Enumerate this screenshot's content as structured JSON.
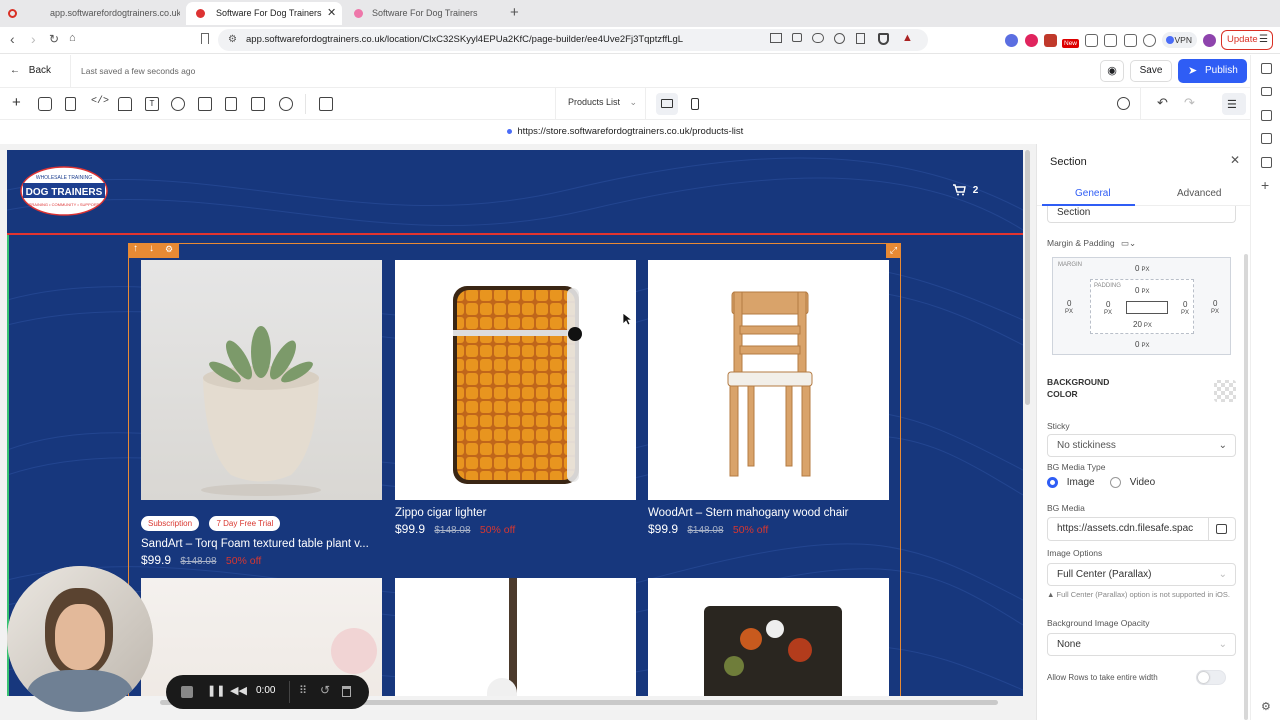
{
  "browser": {
    "tabs": [
      {
        "title": "app.softwarefordogtrainers.co.uk"
      },
      {
        "title": "Software For Dog Trainers",
        "active": true
      },
      {
        "title": "Software For Dog Trainers"
      }
    ],
    "url": "app.softwarefordogtrainers.co.uk/location/ClxC32SKyyl4EPUa2KfC/page-builder/ee4Uve2Fj3TqptzffLgL",
    "vpn_label": "VPN",
    "update_label": "Update",
    "new_badge": "New"
  },
  "builder": {
    "back_label": "Back",
    "saved_status": "Last saved a few seconds ago",
    "save_label": "Save",
    "publish_label": "Publish",
    "page_selector": "Products List",
    "live_url": "https://store.softwarefordogtrainers.co.uk/products-list"
  },
  "store": {
    "logo_small_text": "WHOLESALE TRAINING",
    "logo_text": "DOG TRAINERS",
    "logo_bottom_text": "TRAINING • COMMUNITY • SUPPORT",
    "cart_count": "2",
    "products": [
      {
        "title": "SandArt – Torq Foam textured table plant v...",
        "price": "$99.9",
        "compare_price": "$148.08",
        "discount": "50% off",
        "badges": [
          "Subscription",
          "7 Day Free Trial"
        ]
      },
      {
        "title": "Zippo cigar lighter",
        "price": "$99.9",
        "compare_price": "$148.08",
        "discount": "50% off",
        "badges": []
      },
      {
        "title": "WoodArt – Stern mahogany wood chair",
        "price": "$99.9",
        "compare_price": "$148.08",
        "discount": "50% off",
        "badges": []
      }
    ]
  },
  "panel": {
    "title": "Section",
    "tabs": [
      "General",
      "Advanced"
    ],
    "name_value": "Section",
    "margin_padding_label": "Margin & Padding",
    "margin_label": "MARGIN",
    "padding_label": "PADDING",
    "margin": {
      "top": "0",
      "right": "0",
      "bottom": "0",
      "left": "0"
    },
    "padding": {
      "top": "0",
      "right": "0",
      "bottom": "20",
      "left": "0"
    },
    "unit": "PX",
    "bg_color_label": "BACKGROUND COLOR",
    "sticky_label": "Sticky",
    "sticky_value": "No stickiness",
    "bg_media_type_label": "BG Media Type",
    "media_image": "Image",
    "media_video": "Video",
    "bg_media_label": "BG Media",
    "bg_media_value": "https://assets.cdn.filesafe.spac",
    "image_options_label": "Image Options",
    "image_options_value": "Full Center (Parallax)",
    "parallax_warning": "Full Center (Parallax) option is not supported in iOS.",
    "opacity_label": "Background Image Opacity",
    "opacity_value": "None",
    "rows_width_label": "Allow Rows to take entire width"
  },
  "player": {
    "time": "0:00"
  }
}
